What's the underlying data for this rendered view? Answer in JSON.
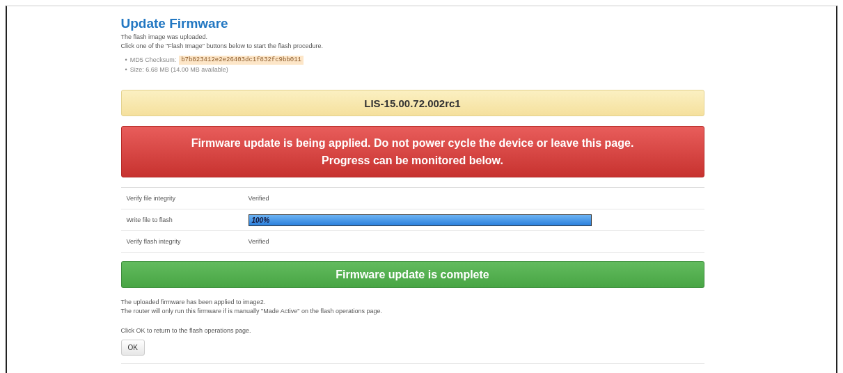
{
  "title": "Update Firmware",
  "intro": [
    "The flash image was uploaded.",
    "Click one of the \"Flash Image\" buttons below to start the flash procedure."
  ],
  "details": [
    {
      "bullet": "•",
      "label": "MD5 Checksum:",
      "code": "b7b823412e2e26403dc1f832fc9bb011"
    },
    {
      "bullet": "•",
      "label": "Size: 6.68 MB (14.00 MB available)"
    }
  ],
  "version_banner": "LIS-15.00.72.002rc1",
  "alerts": [
    {
      "kind": "danger",
      "lines": [
        "Firmware update is being applied. Do not power cycle the device or leave this page.",
        "Progress can be monitored below."
      ]
    }
  ],
  "steps": [
    {
      "name": "Verify file integrity",
      "kind": "text",
      "value": "Verified"
    },
    {
      "name": "Write file to flash",
      "kind": "progress",
      "level": 1,
      "reading": "100%"
    },
    {
      "name": "Verify flash integrity",
      "kind": "text",
      "value": "Verified"
    }
  ],
  "result": {
    "kind": "success",
    "text": "Firmware update is complete"
  },
  "notes": [
    "The uploaded firmware has been applied to image2.",
    "The router will only run this firmware if is manually \"Made Active\" on the flash operations page."
  ],
  "return_note": "Click OK to return to the flash operations page.",
  "ok_button": "OK"
}
